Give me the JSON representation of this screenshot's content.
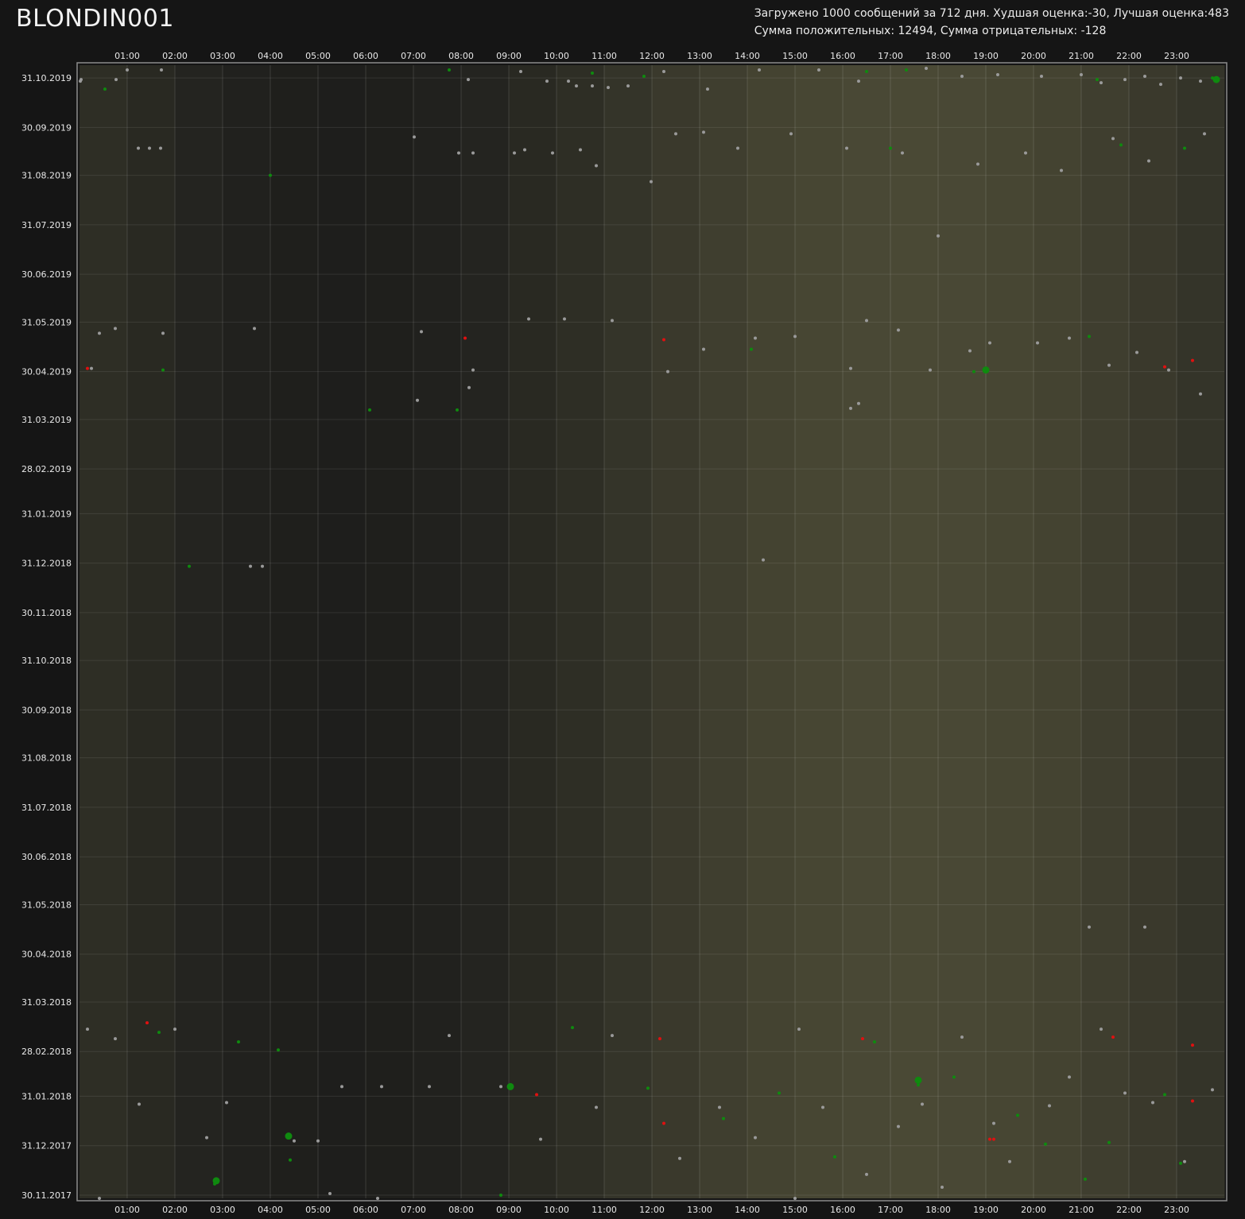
{
  "header": {
    "title": "BLONDIN001",
    "stats_line1": "Загружено 1000 сообщений за 712 дня. Худшая оценка:-30, Лучшая оценка:483",
    "stats_line2": "Сумма положительных: 12494, Сумма отрицательных: -128"
  },
  "chart_data": {
    "type": "scatter",
    "title": "",
    "xlabel": "",
    "ylabel": "",
    "x_ticks": [
      "01:00",
      "02:00",
      "03:00",
      "04:00",
      "05:00",
      "06:00",
      "07:00",
      "08:00",
      "09:00",
      "10:00",
      "11:00",
      "12:00",
      "13:00",
      "14:00",
      "15:00",
      "16:00",
      "17:00",
      "18:00",
      "19:00",
      "20:00",
      "21:00",
      "22:00",
      "23:00"
    ],
    "y_ticks": [
      "31.10.2019",
      "30.09.2019",
      "31.08.2019",
      "31.07.2019",
      "30.06.2019",
      "31.05.2019",
      "30.04.2019",
      "31.03.2019",
      "28.02.2019",
      "31.01.2019",
      "31.12.2018",
      "30.11.2018",
      "31.10.2018",
      "30.09.2018",
      "31.08.2018",
      "31.07.2018",
      "30.06.2018",
      "31.05.2018",
      "30.04.2018",
      "31.03.2018",
      "28.02.2018",
      "31.01.2018",
      "31.12.2017",
      "30.11.2017"
    ],
    "xlim": [
      "00:00",
      "24:00"
    ],
    "ylim": [
      "28.11.2017",
      "08.11.2019"
    ],
    "grid": true,
    "colors": {
      "neutral": "#9a9a9a",
      "positive": "#0f8a0f",
      "negative": "#e01010",
      "background_day": "#4a4935",
      "background_night": "#1e1e1c"
    },
    "series": [
      {
        "color": "neutral",
        "points": [
          {
            "x": "00:01",
            "y": "29.10.2019"
          },
          {
            "x": "00:02",
            "y": "30.10.2019"
          },
          {
            "x": "00:46",
            "y": "30.10.2019"
          },
          {
            "x": "01:00",
            "y": "05.11.2019"
          },
          {
            "x": "01:43",
            "y": "05.11.2019"
          },
          {
            "x": "08:09",
            "y": "30.10.2019"
          },
          {
            "x": "09:15",
            "y": "04.11.2019"
          },
          {
            "x": "09:48",
            "y": "29.10.2019"
          },
          {
            "x": "10:15",
            "y": "29.10.2019"
          },
          {
            "x": "10:25",
            "y": "26.10.2019"
          },
          {
            "x": "10:45",
            "y": "26.10.2019"
          },
          {
            "x": "11:05",
            "y": "25.10.2019"
          },
          {
            "x": "11:30",
            "y": "26.10.2019"
          },
          {
            "x": "12:15",
            "y": "04.11.2019"
          },
          {
            "x": "13:10",
            "y": "24.10.2019"
          },
          {
            "x": "14:15",
            "y": "05.11.2019"
          },
          {
            "x": "15:30",
            "y": "05.11.2019"
          },
          {
            "x": "16:20",
            "y": "29.10.2019"
          },
          {
            "x": "17:45",
            "y": "06.11.2019"
          },
          {
            "x": "18:30",
            "y": "01.11.2019"
          },
          {
            "x": "19:15",
            "y": "02.11.2019"
          },
          {
            "x": "20:10",
            "y": "01.11.2019"
          },
          {
            "x": "21:00",
            "y": "02.11.2019"
          },
          {
            "x": "21:25",
            "y": "28.10.2019"
          },
          {
            "x": "21:55",
            "y": "30.10.2019"
          },
          {
            "x": "22:20",
            "y": "01.11.2019"
          },
          {
            "x": "22:40",
            "y": "27.10.2019"
          },
          {
            "x": "23:05",
            "y": "31.10.2019"
          },
          {
            "x": "23:30",
            "y": "29.10.2019"
          },
          {
            "x": "01:14",
            "y": "17.09.2019"
          },
          {
            "x": "01:28",
            "y": "17.09.2019"
          },
          {
            "x": "01:42",
            "y": "17.09.2019"
          },
          {
            "x": "07:01",
            "y": "24.09.2019"
          },
          {
            "x": "07:57",
            "y": "14.09.2019"
          },
          {
            "x": "08:15",
            "y": "14.09.2019"
          },
          {
            "x": "09:07",
            "y": "14.09.2019"
          },
          {
            "x": "09:20",
            "y": "16.09.2019"
          },
          {
            "x": "09:55",
            "y": "14.09.2019"
          },
          {
            "x": "10:30",
            "y": "16.09.2019"
          },
          {
            "x": "10:50",
            "y": "06.09.2019"
          },
          {
            "x": "11:59",
            "y": "27.08.2019"
          },
          {
            "x": "12:30",
            "y": "26.09.2019"
          },
          {
            "x": "13:05",
            "y": "27.09.2019"
          },
          {
            "x": "13:48",
            "y": "17.09.2019"
          },
          {
            "x": "14:55",
            "y": "26.09.2019"
          },
          {
            "x": "16:05",
            "y": "17.09.2019"
          },
          {
            "x": "17:15",
            "y": "14.09.2019"
          },
          {
            "x": "18:50",
            "y": "07.09.2019"
          },
          {
            "x": "19:50",
            "y": "14.09.2019"
          },
          {
            "x": "20:35",
            "y": "03.09.2019"
          },
          {
            "x": "21:40",
            "y": "23.09.2019"
          },
          {
            "x": "22:25",
            "y": "09.09.2019"
          },
          {
            "x": "23:35",
            "y": "26.09.2019"
          },
          {
            "x": "18:00",
            "y": "24.07.2019"
          },
          {
            "x": "00:25",
            "y": "24.05.2019"
          },
          {
            "x": "00:45",
            "y": "27.05.2019"
          },
          {
            "x": "01:45",
            "y": "24.05.2019"
          },
          {
            "x": "03:40",
            "y": "27.05.2019"
          },
          {
            "x": "07:10",
            "y": "25.05.2019"
          },
          {
            "x": "08:15",
            "y": "01.05.2019"
          },
          {
            "x": "09:25",
            "y": "02.06.2019"
          },
          {
            "x": "10:10",
            "y": "02.06.2019"
          },
          {
            "x": "11:10",
            "y": "01.06.2019"
          },
          {
            "x": "12:20",
            "y": "30.04.2019"
          },
          {
            "x": "13:05",
            "y": "14.05.2019"
          },
          {
            "x": "14:10",
            "y": "21.05.2019"
          },
          {
            "x": "15:00",
            "y": "22.05.2019"
          },
          {
            "x": "16:10",
            "y": "02.05.2019"
          },
          {
            "x": "16:30",
            "y": "01.06.2019"
          },
          {
            "x": "17:10",
            "y": "26.05.2019"
          },
          {
            "x": "17:50",
            "y": "01.05.2019"
          },
          {
            "x": "18:40",
            "y": "13.05.2019"
          },
          {
            "x": "19:05",
            "y": "18.05.2019"
          },
          {
            "x": "20:05",
            "y": "18.05.2019"
          },
          {
            "x": "20:45",
            "y": "21.05.2019"
          },
          {
            "x": "21:35",
            "y": "04.05.2019"
          },
          {
            "x": "22:10",
            "y": "12.05.2019"
          },
          {
            "x": "22:50",
            "y": "01.05.2019"
          },
          {
            "x": "23:30",
            "y": "16.04.2019"
          },
          {
            "x": "00:15",
            "y": "02.05.2019"
          },
          {
            "x": "07:05",
            "y": "12.04.2019"
          },
          {
            "x": "08:10",
            "y": "20.04.2019"
          },
          {
            "x": "16:10",
            "y": "07.04.2019"
          },
          {
            "x": "16:20",
            "y": "10.04.2019"
          },
          {
            "x": "14:20",
            "y": "02.01.2019"
          },
          {
            "x": "03:35",
            "y": "29.12.2018"
          },
          {
            "x": "03:50",
            "y": "29.12.2018"
          },
          {
            "x": "21:10",
            "y": "17.05.2018"
          },
          {
            "x": "22:20",
            "y": "17.05.2018"
          },
          {
            "x": "00:10",
            "y": "14.03.2018"
          },
          {
            "x": "00:45",
            "y": "08.03.2018"
          },
          {
            "x": "01:15",
            "y": "26.01.2018"
          },
          {
            "x": "02:00",
            "y": "14.03.2018"
          },
          {
            "x": "02:40",
            "y": "05.01.2018"
          },
          {
            "x": "03:05",
            "y": "27.01.2018"
          },
          {
            "x": "04:30",
            "y": "03.01.2018"
          },
          {
            "x": "05:00",
            "y": "03.01.2018"
          },
          {
            "x": "05:30",
            "y": "06.02.2018"
          },
          {
            "x": "06:20",
            "y": "06.02.2018"
          },
          {
            "x": "07:20",
            "y": "06.02.2018"
          },
          {
            "x": "07:45",
            "y": "10.03.2018"
          },
          {
            "x": "08:50",
            "y": "06.02.2018"
          },
          {
            "x": "09:40",
            "y": "04.01.2018"
          },
          {
            "x": "10:50",
            "y": "24.01.2018"
          },
          {
            "x": "11:10",
            "y": "10.03.2018"
          },
          {
            "x": "12:35",
            "y": "23.12.2017"
          },
          {
            "x": "13:25",
            "y": "24.01.2018"
          },
          {
            "x": "14:10",
            "y": "05.01.2018"
          },
          {
            "x": "15:05",
            "y": "14.03.2018"
          },
          {
            "x": "15:35",
            "y": "24.01.2018"
          },
          {
            "x": "16:30",
            "y": "13.12.2017"
          },
          {
            "x": "17:10",
            "y": "12.01.2018"
          },
          {
            "x": "17:40",
            "y": "26.01.2018"
          },
          {
            "x": "18:05",
            "y": "05.12.2017"
          },
          {
            "x": "18:30",
            "y": "09.03.2018"
          },
          {
            "x": "19:10",
            "y": "14.01.2018"
          },
          {
            "x": "19:30",
            "y": "21.12.2017"
          },
          {
            "x": "20:20",
            "y": "25.01.2018"
          },
          {
            "x": "20:45",
            "y": "12.02.2018"
          },
          {
            "x": "21:25",
            "y": "14.03.2018"
          },
          {
            "x": "21:55",
            "y": "02.02.2018"
          },
          {
            "x": "22:30",
            "y": "27.01.2018"
          },
          {
            "x": "23:10",
            "y": "21.12.2017"
          },
          {
            "x": "23:45",
            "y": "04.02.2018"
          },
          {
            "x": "00:25",
            "y": "28.11.2017"
          },
          {
            "x": "05:15",
            "y": "01.12.2017"
          },
          {
            "x": "06:15",
            "y": "28.11.2017"
          },
          {
            "x": "15:00",
            "y": "28.11.2017"
          }
        ]
      },
      {
        "color": "positive",
        "points": [
          {
            "x": "00:32",
            "y": "24.10.2019"
          },
          {
            "x": "07:45",
            "y": "05.11.2019"
          },
          {
            "x": "10:45",
            "y": "03.11.2019"
          },
          {
            "x": "11:50",
            "y": "01.11.2019"
          },
          {
            "x": "16:30",
            "y": "04.11.2019"
          },
          {
            "x": "17:20",
            "y": "05.11.2019"
          },
          {
            "x": "21:20",
            "y": "30.10.2019"
          },
          {
            "x": "23:45",
            "y": "31.10.2019"
          },
          {
            "x": "04:00",
            "y": "31.08.2019"
          },
          {
            "x": "17:00",
            "y": "17.09.2019"
          },
          {
            "x": "21:50",
            "y": "19.09.2019"
          },
          {
            "x": "23:10",
            "y": "17.09.2019"
          },
          {
            "x": "01:45",
            "y": "01.05.2019"
          },
          {
            "x": "06:05",
            "y": "06.04.2019"
          },
          {
            "x": "07:55",
            "y": "06.04.2019"
          },
          {
            "x": "14:05",
            "y": "14.05.2019"
          },
          {
            "x": "18:45",
            "y": "30.04.2019"
          },
          {
            "x": "19:00",
            "y": "30.04.2019"
          },
          {
            "x": "21:10",
            "y": "22.05.2019"
          },
          {
            "x": "02:18",
            "y": "29.12.2018"
          },
          {
            "x": "01:40",
            "y": "12.03.2018"
          },
          {
            "x": "03:20",
            "y": "06.03.2018"
          },
          {
            "x": "04:10",
            "y": "01.03.2018"
          },
          {
            "x": "04:25",
            "y": "22.12.2017"
          },
          {
            "x": "09:03",
            "y": "05.02.2018"
          },
          {
            "x": "10:20",
            "y": "15.03.2018"
          },
          {
            "x": "11:55",
            "y": "05.02.2018"
          },
          {
            "x": "13:30",
            "y": "17.01.2018"
          },
          {
            "x": "14:40",
            "y": "02.02.2018"
          },
          {
            "x": "15:50",
            "y": "24.12.2017"
          },
          {
            "x": "16:40",
            "y": "06.03.2018"
          },
          {
            "x": "17:35",
            "y": "07.02.2018"
          },
          {
            "x": "18:20",
            "y": "12.02.2018"
          },
          {
            "x": "19:40",
            "y": "19.01.2018"
          },
          {
            "x": "20:15",
            "y": "01.01.2018"
          },
          {
            "x": "21:05",
            "y": "10.12.2017"
          },
          {
            "x": "21:35",
            "y": "02.01.2018"
          },
          {
            "x": "22:45",
            "y": "01.02.2018"
          },
          {
            "x": "23:05",
            "y": "20.12.2017"
          },
          {
            "x": "02:50",
            "y": "07.12.2017"
          },
          {
            "x": "08:50",
            "y": "30.11.2017"
          }
        ]
      },
      {
        "color": "negative",
        "points": [
          {
            "x": "00:10",
            "y": "02.05.2019"
          },
          {
            "x": "08:05",
            "y": "21.05.2019"
          },
          {
            "x": "12:15",
            "y": "20.05.2019"
          },
          {
            "x": "22:45",
            "y": "03.05.2019"
          },
          {
            "x": "23:20",
            "y": "07.05.2019"
          },
          {
            "x": "01:25",
            "y": "18.03.2018"
          },
          {
            "x": "09:35",
            "y": "01.02.2018"
          },
          {
            "x": "12:10",
            "y": "08.03.2018"
          },
          {
            "x": "12:15",
            "y": "14.01.2018"
          },
          {
            "x": "16:25",
            "y": "08.03.2018"
          },
          {
            "x": "19:05",
            "y": "04.01.2018"
          },
          {
            "x": "19:10",
            "y": "04.01.2018"
          },
          {
            "x": "21:40",
            "y": "09.03.2018"
          },
          {
            "x": "23:20",
            "y": "04.03.2018"
          },
          {
            "x": "23:20",
            "y": "28.01.2018"
          }
        ]
      },
      {
        "color": "positive",
        "size": "large",
        "points": [
          {
            "x": "17:35",
            "y": "10.02.2018"
          },
          {
            "x": "09:02",
            "y": "06.02.2018"
          },
          {
            "x": "04:23",
            "y": "06.01.2018"
          },
          {
            "x": "02:52",
            "y": "09.12.2017"
          },
          {
            "x": "19:00",
            "y": "01.05.2019"
          },
          {
            "x": "23:50",
            "y": "30.10.2019"
          }
        ]
      }
    ]
  }
}
